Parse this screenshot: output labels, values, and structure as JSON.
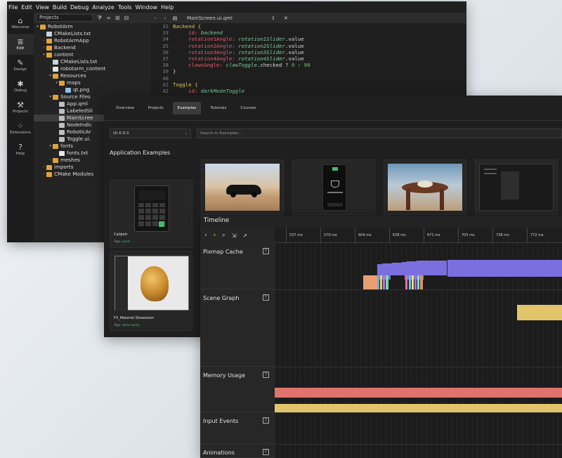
{
  "editor": {
    "menu": [
      "File",
      "Edit",
      "View",
      "Build",
      "Debug",
      "Analyze",
      "Tools",
      "Window",
      "Help"
    ],
    "modes": [
      {
        "label": "Welcome",
        "icon": "⌂"
      },
      {
        "label": "Edit",
        "icon": "≣"
      },
      {
        "label": "Design",
        "icon": "✎"
      },
      {
        "label": "Debug",
        "icon": "✱"
      },
      {
        "label": "Projects",
        "icon": "⚒"
      },
      {
        "label": "Extensions",
        "icon": "⁘"
      },
      {
        "label": "Help",
        "icon": "?"
      }
    ],
    "projects_selector": "Projects",
    "tree": [
      {
        "label": "RobotArm",
        "depth": 0,
        "icon": "folder",
        "arrow": "▾"
      },
      {
        "label": "CMakeLists.txt",
        "depth": 1,
        "icon": "cmake",
        "arrow": ""
      },
      {
        "label": "RobotArmApp",
        "depth": 1,
        "icon": "folder",
        "arrow": "›"
      },
      {
        "label": "Backend",
        "depth": 1,
        "icon": "folder",
        "arrow": "›"
      },
      {
        "label": "content",
        "depth": 1,
        "icon": "folder",
        "arrow": "▾"
      },
      {
        "label": "CMakeLists.txt",
        "depth": 2,
        "icon": "cmake",
        "arrow": ""
      },
      {
        "label": "robotarm_content",
        "depth": 2,
        "icon": "file",
        "arrow": "›"
      },
      {
        "label": "Resources",
        "depth": 2,
        "icon": "folder",
        "arrow": "▾"
      },
      {
        "label": "maps",
        "depth": 3,
        "icon": "folder",
        "arrow": "▾"
      },
      {
        "label": "qt.png",
        "depth": 4,
        "icon": "img",
        "arrow": ""
      },
      {
        "label": "Source Files",
        "depth": 2,
        "icon": "folder",
        "arrow": "▾"
      },
      {
        "label": "App.qml",
        "depth": 3,
        "icon": "qml",
        "arrow": ""
      },
      {
        "label": "LabeledSli",
        "depth": 3,
        "icon": "qml",
        "arrow": ""
      },
      {
        "label": "MainScree",
        "depth": 3,
        "icon": "qml",
        "arrow": "",
        "selected": true
      },
      {
        "label": "NodeIndic",
        "depth": 3,
        "icon": "qml",
        "arrow": ""
      },
      {
        "label": "RoboticAr",
        "depth": 3,
        "icon": "qml",
        "arrow": ""
      },
      {
        "label": "Toggle.ui.",
        "depth": 3,
        "icon": "qml",
        "arrow": ""
      },
      {
        "label": "fonts",
        "depth": 2,
        "icon": "folder",
        "arrow": "▾"
      },
      {
        "label": "fonts.txt",
        "depth": 3,
        "icon": "file",
        "arrow": ""
      },
      {
        "label": "meshes",
        "depth": 2,
        "icon": "folder",
        "arrow": "›"
      },
      {
        "label": "imports",
        "depth": 1,
        "icon": "folder",
        "arrow": "›"
      },
      {
        "label": "CMake Modules",
        "depth": 1,
        "icon": "folder",
        "arrow": "›"
      }
    ],
    "open_file": "MainScreen.ui.qml",
    "code": [
      {
        "n": "32",
        "indent": 0,
        "parts": [
          [
            "kw",
            "Backend {"
          ]
        ]
      },
      {
        "n": "33",
        "indent": 1,
        "parts": [
          [
            "red",
            "id: "
          ],
          [
            "id",
            "backend"
          ]
        ]
      },
      {
        "n": "34",
        "indent": 1,
        "parts": [
          [
            "red",
            "rotation1Angle: "
          ],
          [
            "id",
            "rotation1Slider"
          ],
          [
            "pl",
            ".value"
          ]
        ]
      },
      {
        "n": "35",
        "indent": 1,
        "parts": [
          [
            "red",
            "rotation2Angle: "
          ],
          [
            "id",
            "rotation2Slider"
          ],
          [
            "pl",
            ".value"
          ]
        ]
      },
      {
        "n": "36",
        "indent": 1,
        "parts": [
          [
            "red",
            "rotation3Angle: "
          ],
          [
            "id",
            "rotation3Slider"
          ],
          [
            "pl",
            ".value"
          ]
        ]
      },
      {
        "n": "37",
        "indent": 1,
        "parts": [
          [
            "red",
            "rotation4Angle: "
          ],
          [
            "id",
            "rotation4Slider"
          ],
          [
            "pl",
            ".value"
          ]
        ]
      },
      {
        "n": "38",
        "indent": 1,
        "parts": [
          [
            "red",
            "clawsAngle: "
          ],
          [
            "id",
            "clawToggle"
          ],
          [
            "pl",
            ".checked ? "
          ],
          [
            "val",
            "0"
          ],
          [
            "pl",
            " : "
          ],
          [
            "val",
            "90"
          ]
        ]
      },
      {
        "n": "39",
        "indent": 0,
        "parts": [
          [
            "pl",
            "}"
          ]
        ]
      },
      {
        "n": "40",
        "indent": 0,
        "parts": [
          [
            "pl",
            ""
          ]
        ]
      },
      {
        "n": "41",
        "indent": 0,
        "parts": [
          [
            "kw",
            "Toggle {"
          ]
        ]
      },
      {
        "n": "42",
        "indent": 1,
        "parts": [
          [
            "red",
            "id: "
          ],
          [
            "id",
            "darkModeToggle"
          ]
        ]
      }
    ]
  },
  "welcome": {
    "tabs": [
      "Overview",
      "Projects",
      "Examples",
      "Tutorials",
      "Courses"
    ],
    "active_tab": "Examples",
    "version": "Qt 6.9.3",
    "search_placeholder": "Search in Examples...",
    "section_title": "Application Examples",
    "cards": [
      {
        "name": "Calqlatr",
        "tags_label": "Tags:",
        "tags": "quick"
      },
      {
        "name": "FX_Material Showroom",
        "tags_label": "Tags:",
        "tags": "demo  quick"
      }
    ]
  },
  "timeline": {
    "title": "Timeline",
    "ticks": [
      "537 ms",
      "570 ms",
      "604 ms",
      "638 ms",
      "671 ms",
      "705 ms",
      "738 ms",
      "772 ms"
    ],
    "lanes": [
      "Pixmap Cache",
      "Scene Graph",
      "Memory Usage",
      "Input Events",
      "Animations"
    ],
    "colors": {
      "pixmap_purple": "#7b6fe0",
      "scene_yellow": "#e2c46a",
      "memory_red": "#e0736e",
      "memory_yellow": "#e2c46a",
      "accent_green": "#3fbf6f"
    }
  }
}
